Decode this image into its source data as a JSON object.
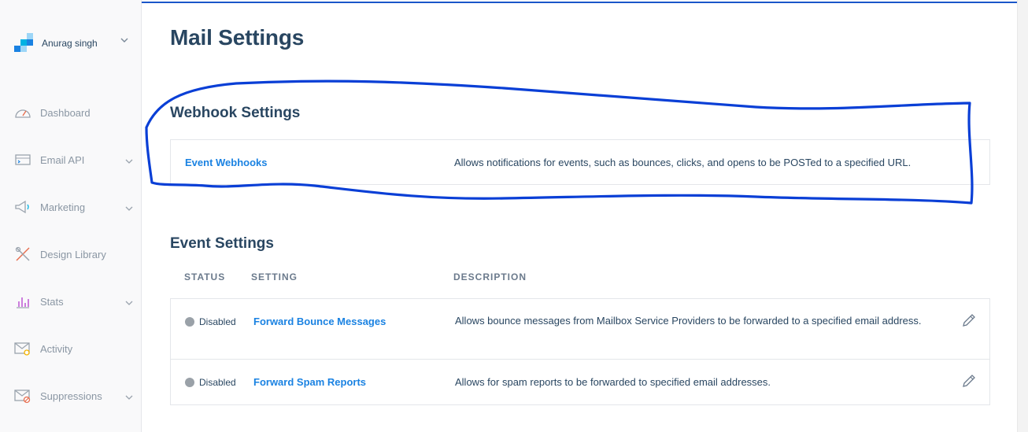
{
  "account": {
    "name": "Anurag singh",
    "logo_icon": "sendgrid-logo-icon"
  },
  "sidebar": {
    "items": [
      {
        "label": "Dashboard",
        "icon": "dashboard-gauge-icon",
        "has_chevron": false
      },
      {
        "label": "Email API",
        "icon": "email-api-icon",
        "has_chevron": true
      },
      {
        "label": "Marketing",
        "icon": "megaphone-icon",
        "has_chevron": true
      },
      {
        "label": "Design Library",
        "icon": "design-tools-icon",
        "has_chevron": false
      },
      {
        "label": "Stats",
        "icon": "stats-bars-icon",
        "has_chevron": true
      },
      {
        "label": "Activity",
        "icon": "activity-envelope-icon",
        "has_chevron": false
      },
      {
        "label": "Suppressions",
        "icon": "suppressions-icon",
        "has_chevron": true
      }
    ]
  },
  "main": {
    "title": "Mail Settings",
    "webhook_section": {
      "title": "Webhook Settings",
      "link": "Event Webhooks",
      "description": "Allows notifications for events, such as bounces, clicks, and opens to be POSTed to a specified URL."
    },
    "event_section": {
      "title": "Event Settings",
      "columns": [
        "STATUS",
        "SETTING",
        "DESCRIPTION"
      ],
      "rows": [
        {
          "status": "Disabled",
          "setting": "Forward Bounce Messages",
          "description": "Allows bounce messages from Mailbox Service Providers to be forwarded to a specified email address."
        },
        {
          "status": "Disabled",
          "setting": "Forward Spam Reports",
          "description": "Allows for spam reports to be forwarded to specified email addresses."
        }
      ]
    }
  },
  "colors": {
    "accent_link": "#1a82e2",
    "text_dark": "#294661",
    "annotation_stroke": "#0a3fd6",
    "status_disabled": "#9aa1a8"
  }
}
